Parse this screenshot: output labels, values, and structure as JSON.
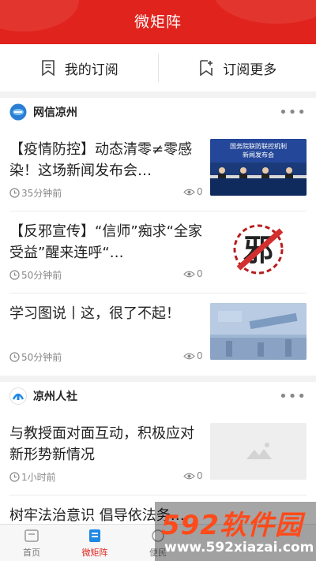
{
  "header": {
    "title": "微矩阵"
  },
  "subscription": {
    "my_subscriptions": "我的订阅",
    "subscribe_more": "订阅更多"
  },
  "sections": [
    {
      "name": "网信凉州",
      "items": [
        {
          "title": "【疫情防控】动态清零≠零感染！这场新闻发布会…",
          "time": "35分钟前",
          "views": "0"
        },
        {
          "title": "【反邪宣传】“信师”痴求“全家受益”醒来连呼“…",
          "time": "50分钟前",
          "views": "0"
        },
        {
          "title": "学习图说丨这，很了不起！",
          "time": "50分钟前",
          "views": "0"
        }
      ]
    },
    {
      "name": "凉州人社",
      "items": [
        {
          "title": "与教授面对面互动，积极应对新形势新情况",
          "time": "1小时前",
          "views": "0"
        },
        {
          "title": "树牢法治意识 倡导依法务…",
          "time": "",
          "views": ""
        }
      ]
    }
  ],
  "thumbs": {
    "press": {
      "line1": "国务院联防联控机制",
      "line2": "新闻发布会"
    },
    "anticult": {
      "char": "邪"
    }
  },
  "bottom_nav": {
    "tabs": [
      {
        "label": "首页"
      },
      {
        "label": "微矩阵"
      },
      {
        "label": "便民"
      }
    ]
  },
  "watermark": {
    "brand": "592软件园",
    "url": "www.592xiazai.com"
  },
  "colors": {
    "accent": "#e0241d",
    "meta": "#888888"
  }
}
